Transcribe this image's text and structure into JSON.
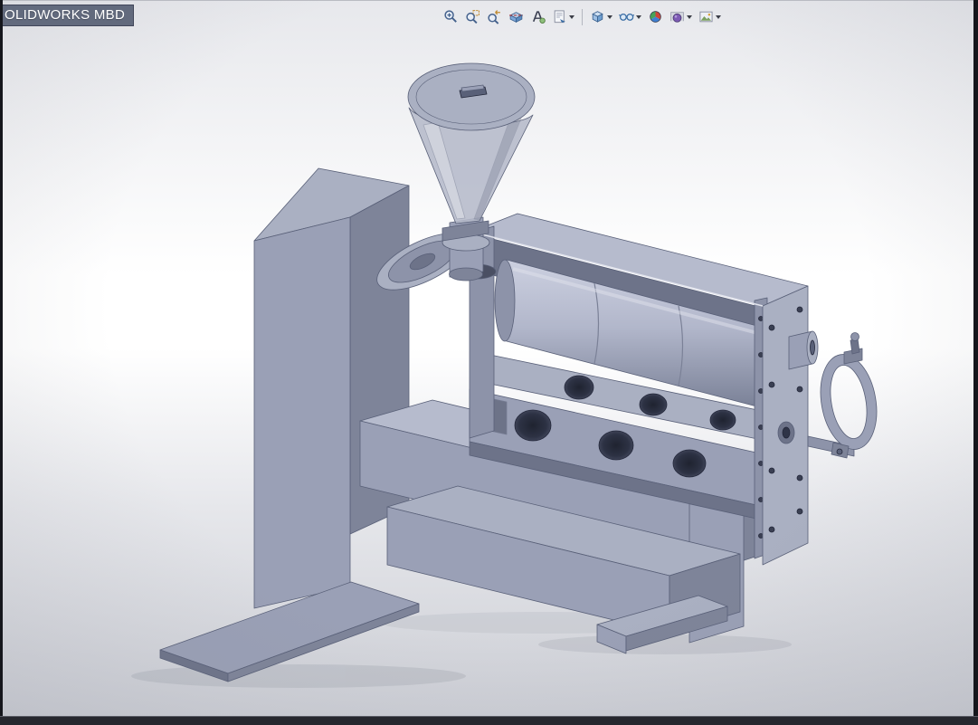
{
  "window": {
    "title_chip": "OLIDWORKS MBD"
  },
  "toolbar": {
    "items": [
      {
        "name": "zoom-to-fit",
        "has_dropdown": false
      },
      {
        "name": "zoom-to-area",
        "has_dropdown": false
      },
      {
        "name": "previous-view",
        "has_dropdown": false
      },
      {
        "name": "section-view",
        "has_dropdown": false
      },
      {
        "name": "dynamic-annotation-views",
        "has_dropdown": false
      },
      {
        "name": "annotation-views",
        "has_dropdown": true
      },
      {
        "type": "divider"
      },
      {
        "name": "view-orientation",
        "has_dropdown": true
      },
      {
        "name": "hide-show-items",
        "has_dropdown": true
      },
      {
        "name": "edit-appearance",
        "has_dropdown": false
      },
      {
        "name": "apply-scene",
        "has_dropdown": true
      },
      {
        "name": "view-settings",
        "has_dropdown": true
      }
    ]
  },
  "model": {
    "subject": "3D CAD model of a single-screw extruder machine on an L-shaped stand",
    "parts": [
      "hopper-with-lid",
      "feed-section-discs",
      "barrel-with-open-front",
      "inner-drum",
      "perforated-panels",
      "end-plate-with-bolt-holes",
      "outlet-nozzle",
      "outlet-shaft",
      "dial-clamp",
      "stand-column",
      "base-plate",
      "table-beam",
      "lower-shelf",
      "support-foot"
    ]
  },
  "palette": {
    "model_light": "#b6bbcd",
    "model_mid": "#9aa0b6",
    "model_dark": "#7e8499",
    "model_darker": "#6d7389",
    "model_steel": "#8d93a9",
    "model_pale": "#aab0c2",
    "model_edge": "#596078",
    "hole": "#30354a",
    "bg_top": "#e7e8ec",
    "bg_mid": "#ffffff",
    "bg_bottom": "#cbcdd4",
    "frame": "#15161c",
    "bottom_bar": "#26272e",
    "chip_bg": "#626a7d",
    "chip_text": "#ffffff"
  }
}
